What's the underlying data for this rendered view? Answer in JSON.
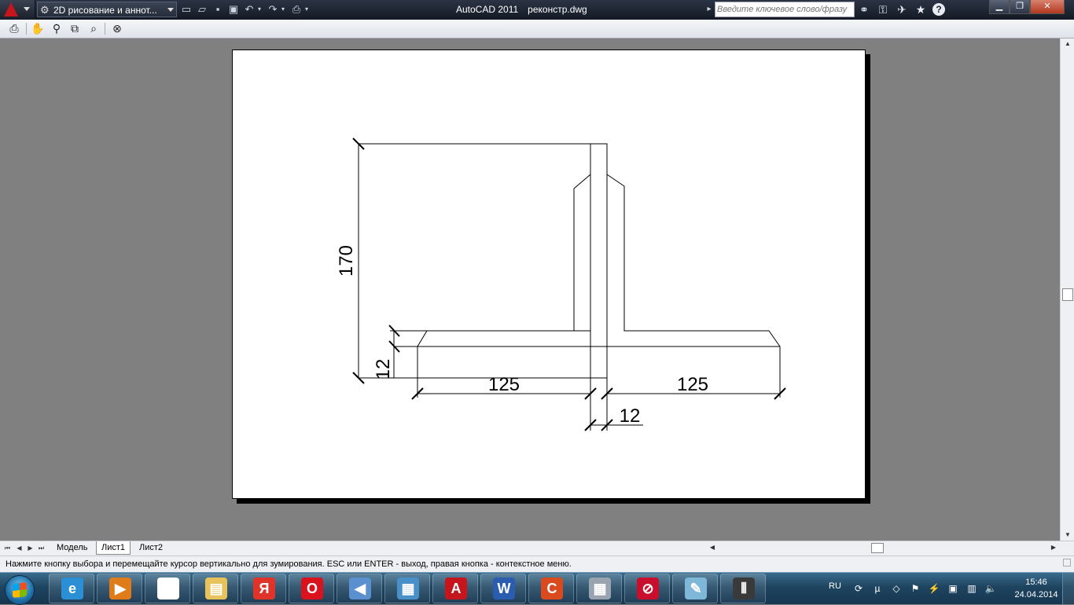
{
  "titlebar": {
    "workspace": "2D рисование и аннот...",
    "app_name": "AutoCAD 2011",
    "file_name": "реконстр.dwg",
    "search_placeholder": "Введите ключевое слово/фразу",
    "qat_icons": [
      "new-icon",
      "open-icon",
      "save-icon",
      "saveas-icon",
      "undo-icon",
      "redo-icon",
      "plot-icon"
    ],
    "info_icons": [
      "binoculars-icon",
      "key-icon",
      "satellite-icon",
      "star-icon",
      "help-icon"
    ],
    "window_buttons": [
      "minimize",
      "restore",
      "close"
    ]
  },
  "toolbar": {
    "icons": [
      "print-icon",
      "pan-hand-icon",
      "zoom-icon",
      "zoom-window-icon",
      "zoom-previous-icon",
      "close-preview-icon"
    ]
  },
  "drawing": {
    "dims": {
      "height_total": "170",
      "flange_thickness": "12",
      "left_flange": "125",
      "right_flange": "125",
      "web_thickness": "12"
    }
  },
  "tabs": {
    "items": [
      "Модель",
      "Лист1",
      "Лист2"
    ],
    "active_index": 1
  },
  "statusline": {
    "message": "Нажмите кнопку выбора и перемещайте курсор вертикально для зумирования. ESC или ENTER - выход, правая кнопка - контекстное меню."
  },
  "taskbar": {
    "apps": [
      {
        "name": "internet-explorer",
        "glyph": "e",
        "color": "#2b8fd6"
      },
      {
        "name": "media-player",
        "glyph": "▶",
        "color": "#e07b1a"
      },
      {
        "name": "blank-document",
        "glyph": "",
        "color": "#ffffff"
      },
      {
        "name": "file-explorer",
        "glyph": "▤",
        "color": "#e8c25a"
      },
      {
        "name": "yandex-browser",
        "glyph": "Я",
        "color": "#e0342a"
      },
      {
        "name": "opera",
        "glyph": "O",
        "color": "#d9121c"
      },
      {
        "name": "speaker-app",
        "glyph": "◀",
        "color": "#5a8fd0"
      },
      {
        "name": "control-panel",
        "glyph": "▦",
        "color": "#4a90c8"
      },
      {
        "name": "autocad",
        "glyph": "A",
        "color": "#c4161c"
      },
      {
        "name": "word",
        "glyph": "W",
        "color": "#2a5db0"
      },
      {
        "name": "ccleaner",
        "glyph": "C",
        "color": "#d94a1e"
      },
      {
        "name": "calculator",
        "glyph": "▦",
        "color": "#9aa4b0"
      },
      {
        "name": "no-sign-app",
        "glyph": "⊘",
        "color": "#c8102e"
      },
      {
        "name": "notes-app",
        "glyph": "✎",
        "color": "#7fb7d8"
      },
      {
        "name": "cad-app",
        "glyph": "⫴",
        "color": "#3a3a3a"
      }
    ],
    "language": "RU",
    "time": "15:46",
    "date": "24.04.2014"
  }
}
